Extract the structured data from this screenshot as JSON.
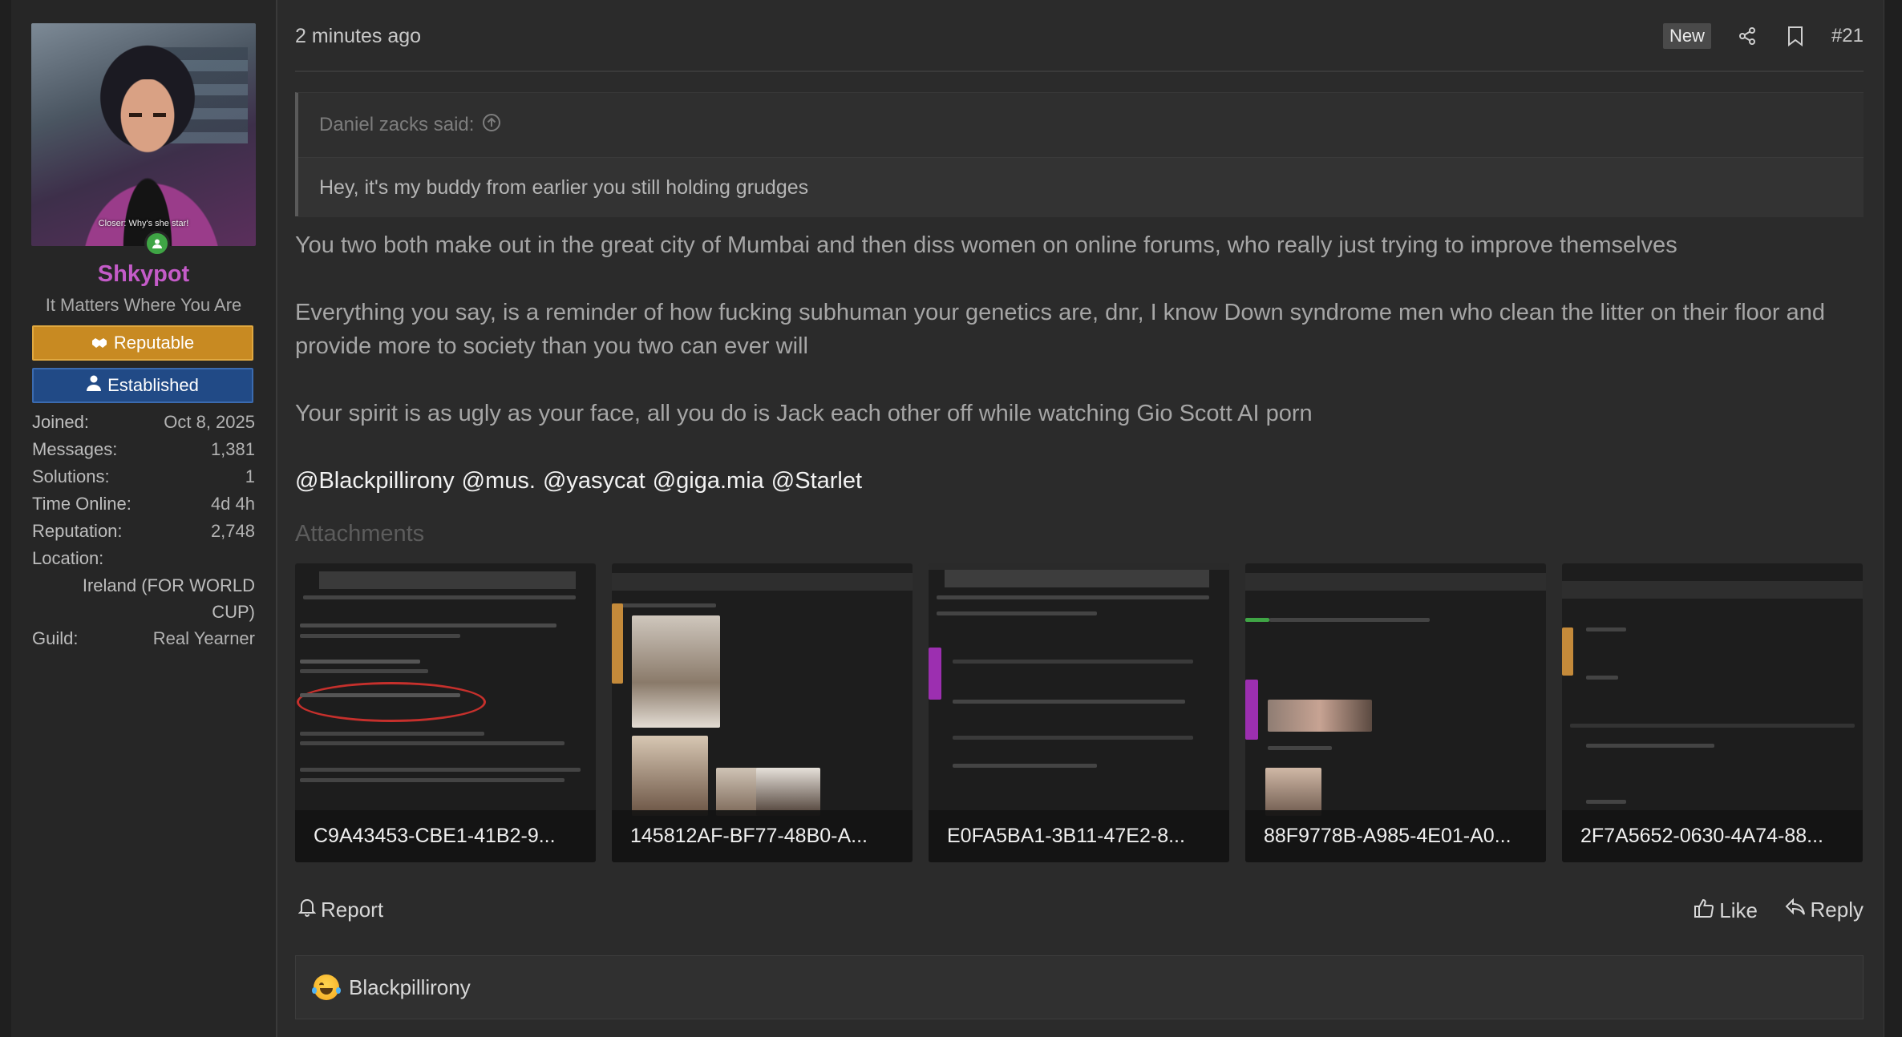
{
  "user": {
    "avatar_caption": "Closer: Why's she star!",
    "username": "Shkypot",
    "title": "It Matters Where You Are",
    "banners": [
      "Reputable",
      "Established"
    ],
    "stats": [
      {
        "label": "Joined:",
        "value": "Oct 8, 2025"
      },
      {
        "label": "Messages:",
        "value": "1,381"
      },
      {
        "label": "Solutions:",
        "value": "1"
      },
      {
        "label": "Time Online:",
        "value": "4d 4h"
      },
      {
        "label": "Reputation:",
        "value": "2,748"
      }
    ],
    "location_label": "Location:",
    "location_value": "Ireland (FOR WORLD CUP)",
    "guild_label": "Guild:",
    "guild_value": "Real Yearner"
  },
  "post": {
    "time": "2 minutes ago",
    "badge_new": "New",
    "post_number": "#21",
    "quote_author": "Daniel zacks said:",
    "quote_text": "Hey, it's my buddy from earlier you still holding grudges",
    "paragraphs": [
      "You two both make out in the great city of Mumbai and then diss women on online forums, who really just trying to improve themselves",
      "Everything you say, is a reminder of how fucking subhuman your genetics are, dnr, I know Down syndrome men who clean the litter on their floor and provide more to society than you two can ever will",
      "Your spirit is as ugly as your face, all you do is Jack each other off while watching Gio Scott AI porn"
    ],
    "mentions": [
      "@Blackpillirony",
      "@mus.",
      "@yasycat",
      "@giga.mia",
      "@Starlet"
    ],
    "attachments_label": "Attachments",
    "attachments": [
      "C9A43453-CBE1-41B2-9...",
      "145812AF-BF77-48B0-A...",
      "E0FA5BA1-3B11-47E2-8...",
      "88F9778B-A985-4E01-A0...",
      "2F7A5652-0630-4A74-88..."
    ],
    "actions": {
      "report": "Report",
      "like": "Like",
      "reply": "Reply"
    },
    "reaction_user": "Blackpillirony"
  },
  "colors": {
    "username": "#c45bc8",
    "reputable": "#c88a22",
    "established": "#214a86",
    "online": "#3fa545"
  }
}
